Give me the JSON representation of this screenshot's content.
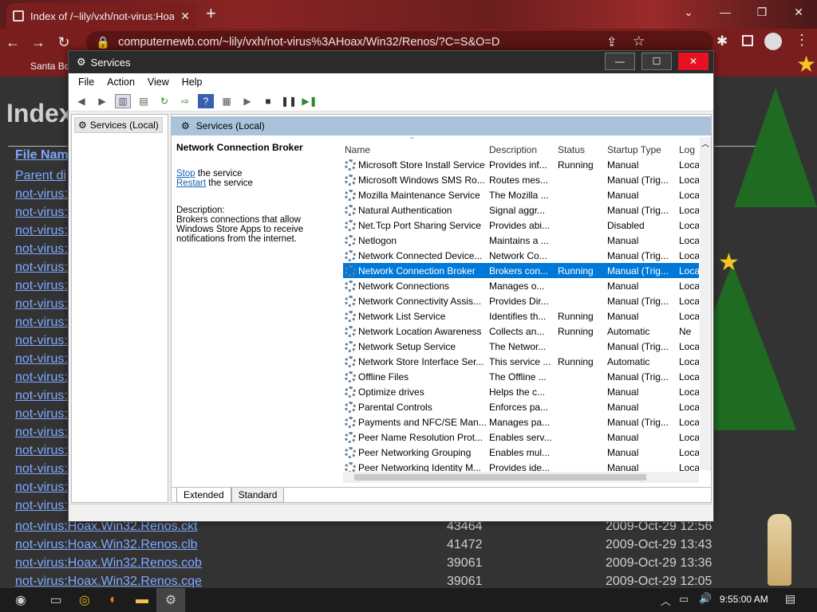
{
  "browser": {
    "tab_title": "Index of /~lily/vxh/not-virus:Hoa",
    "url": "computernewb.com/~lily/vxh/not-virus%3AHoax/Win32/Renos/?C=S&O=D",
    "bookmark": "Santa Bo"
  },
  "page": {
    "title_fragment": "Index",
    "header_file_name": "File Nam",
    "parent_link": "Parent di",
    "truncated_link": "not-virus:",
    "rows": [
      {
        "name": "not-virus:Hoax.Win32.Renos.ckt",
        "size": "43464",
        "date": "2009-Oct-29 12:56"
      },
      {
        "name": "not-virus:Hoax.Win32.Renos.clb",
        "size": "41472",
        "date": "2009-Oct-29 13:43"
      },
      {
        "name": "not-virus:Hoax.Win32.Renos.cob",
        "size": "39061",
        "date": "2009-Oct-29 13:36"
      },
      {
        "name": "not-virus:Hoax.Win32.Renos.cqe",
        "size": "39061",
        "date": "2009-Oct-29 12:05"
      }
    ]
  },
  "services": {
    "window_title": "Services",
    "menu": [
      "File",
      "Action",
      "View",
      "Help"
    ],
    "tree_item": "Services (Local)",
    "pane_header": "Services (Local)",
    "selected_name": "Network Connection Broker",
    "stop_link": "Stop",
    "stop_suffix": " the service",
    "restart_link": "Restart",
    "restart_suffix": " the service",
    "desc_label": "Description:",
    "desc_text": "Brokers connections that allow Windows Store Apps to receive notifications from the internet.",
    "columns": [
      "Name",
      "Description",
      "Status",
      "Startup Type",
      "Log"
    ],
    "rows": [
      [
        "Microsoft Store Install Service",
        "Provides inf...",
        "Running",
        "Manual",
        "Loca"
      ],
      [
        "Microsoft Windows SMS Ro...",
        "Routes mes...",
        "",
        "Manual (Trig...",
        "Loca"
      ],
      [
        "Mozilla Maintenance Service",
        "The Mozilla ...",
        "",
        "Manual",
        "Loca"
      ],
      [
        "Natural Authentication",
        "Signal aggr...",
        "",
        "Manual (Trig...",
        "Loca"
      ],
      [
        "Net.Tcp Port Sharing Service",
        "Provides abi...",
        "",
        "Disabled",
        "Loca"
      ],
      [
        "Netlogon",
        "Maintains a ...",
        "",
        "Manual",
        "Loca"
      ],
      [
        "Network Connected Device...",
        "Network Co...",
        "",
        "Manual (Trig...",
        "Loca"
      ],
      [
        "Network Connection Broker",
        "Brokers con...",
        "Running",
        "Manual (Trig...",
        "Loca"
      ],
      [
        "Network Connections",
        "Manages o...",
        "",
        "Manual",
        "Loca"
      ],
      [
        "Network Connectivity Assis...",
        "Provides Dir...",
        "",
        "Manual (Trig...",
        "Loca"
      ],
      [
        "Network List Service",
        "Identifies th...",
        "Running",
        "Manual",
        "Loca"
      ],
      [
        "Network Location Awareness",
        "Collects an...",
        "Running",
        "Automatic",
        "Ne"
      ],
      [
        "Network Setup Service",
        "The Networ...",
        "",
        "Manual (Trig...",
        "Loca"
      ],
      [
        "Network Store Interface Ser...",
        "This service ...",
        "Running",
        "Automatic",
        "Loca"
      ],
      [
        "Offline Files",
        "The Offline ...",
        "",
        "Manual (Trig...",
        "Loca"
      ],
      [
        "Optimize drives",
        "Helps the c...",
        "",
        "Manual",
        "Loca"
      ],
      [
        "Parental Controls",
        "Enforces pa...",
        "",
        "Manual",
        "Loca"
      ],
      [
        "Payments and NFC/SE Man...",
        "Manages pa...",
        "",
        "Manual (Trig...",
        "Loca"
      ],
      [
        "Peer Name Resolution Prot...",
        "Enables serv...",
        "",
        "Manual",
        "Loca"
      ],
      [
        "Peer Networking Grouping",
        "Enables mul...",
        "",
        "Manual",
        "Loca"
      ],
      [
        "Peer Networking Identity M...",
        "Provides ide...",
        "",
        "Manual",
        "Loca"
      ]
    ],
    "selected_index": 7,
    "tabs": [
      "Extended",
      "Standard"
    ]
  },
  "taskbar": {
    "time": "9:55:00 AM"
  },
  "colors": {
    "selection": "#0078d7",
    "link": "#7fa9ff",
    "chrome": "#7a1d1d"
  }
}
